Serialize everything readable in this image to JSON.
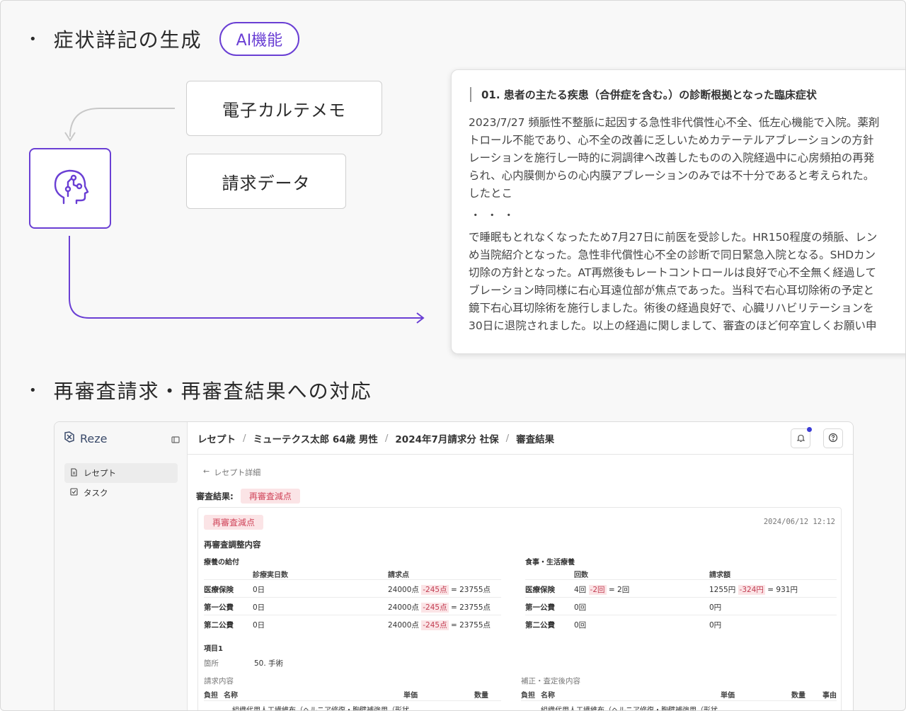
{
  "section1": {
    "bullet": "•",
    "title": "症状詳記の生成",
    "badge": "AI機能"
  },
  "sources": {
    "memo": "電子カルテメモ",
    "billing": "請求データ"
  },
  "icons": {
    "ai": "ai-head-icon"
  },
  "output": {
    "title": "01. 患者の主たる疾患（合併症を含む。）の診断根拠となった臨床症状",
    "para1": [
      "2023/7/27 頻脈性不整脈に起因する急性非代償性心不全、低左心機能で入院。薬剤",
      "トロール不能であり、心不全の改善に乏しいためカテーテルアブレーションの方針",
      "レーションを施行し一時的に洞調律へ改善したものの入院経過中に心房頻拍の再発",
      "られ、心内膜側からの心内膜アブレーションのみでは不十分であると考えられた。",
      "したとこ"
    ],
    "dots": "・・・",
    "para2": [
      "で睡眠もとれなくなったため7月27日に前医を受診した。HR150程度の頻脈、レン",
      "め当院紹介となった。急性非代償性心不全の診断で同日緊急入院となる。SHDカン",
      "切除の方針となった。AT再燃後もレートコントロールは良好で心不全無く経過して",
      "ブレーション時同様に右心耳遠位部が焦点であった。当科で右心耳切除術の予定と",
      "鏡下右心耳切除術を施行しました。術後の経過良好で、心臓リハビリテーションを",
      "30日に退院されました。以上の経過に関しまして、審査のほど何卒宜しくお願い申"
    ]
  },
  "section2": {
    "bullet": "•",
    "title": "再審査請求・再審査結果への対応"
  },
  "app": {
    "logo": "Reze",
    "nav": [
      {
        "label": "レセプト",
        "icon": "document-icon"
      },
      {
        "label": "タスク",
        "icon": "checkbox-icon"
      }
    ],
    "breadcrumb": [
      "レセプト",
      "ミューテクス太郎 64歳 男性",
      "2024年7月請求分 社保",
      "審査結果"
    ],
    "breadcrumb_sep": "/",
    "back_label": "レセプト詳細",
    "result_label": "審査結果:",
    "result_tag": "再審査減点",
    "card": {
      "tag": "再審査減点",
      "date": "2024/06/12 12:12",
      "title": "再審査調整内容",
      "left": {
        "subtitle": "療養の給付",
        "headers": [
          "診療実日数",
          "請求点"
        ],
        "rows": [
          {
            "name": "医療保険",
            "days": "0日",
            "base": "24000点",
            "diff": "-245点",
            "eq": "=",
            "result": "23755点"
          },
          {
            "name": "第一公費",
            "days": "0日",
            "base": "24000点",
            "diff": "-245点",
            "eq": "=",
            "result": "23755点"
          },
          {
            "name": "第二公費",
            "days": "0日",
            "base": "24000点",
            "diff": "-245点",
            "eq": "=",
            "result": "23755点"
          }
        ]
      },
      "right": {
        "subtitle": "食事・生活療養",
        "headers": [
          "回数",
          "請求額"
        ],
        "rows": [
          {
            "name": "医療保険",
            "count": "4回",
            "count_diff": "-2回",
            "eq": "=",
            "count_result": "2回",
            "amount": "1255円",
            "amount_diff": "-324円",
            "amount_result": "931円"
          },
          {
            "name": "第一公費",
            "count": "0回",
            "amount": "0円"
          },
          {
            "name": "第二公費",
            "count": "0回",
            "amount": "0円"
          }
        ]
      },
      "item": {
        "title": "項目1",
        "place_label": "箇所",
        "place_value": "50. 手術"
      },
      "request": {
        "title": "請求内容",
        "headers": [
          "負担",
          "名称",
          "単価",
          "数量"
        ],
        "row_name": "組織代用人工繊維布（ヘルニア修復・胸壁補強用（形状"
      },
      "adjust": {
        "title": "補正・査定後内容",
        "headers": [
          "負担",
          "名称",
          "単価",
          "数量",
          "事由"
        ],
        "row_name": "組織代用人工繊維布（ヘルニア修復・胸壁補強用（形状"
      }
    }
  },
  "colors": {
    "accent": "#6a3fd4",
    "negative": "#c23d52",
    "negative_bg": "#fbe4e6"
  }
}
